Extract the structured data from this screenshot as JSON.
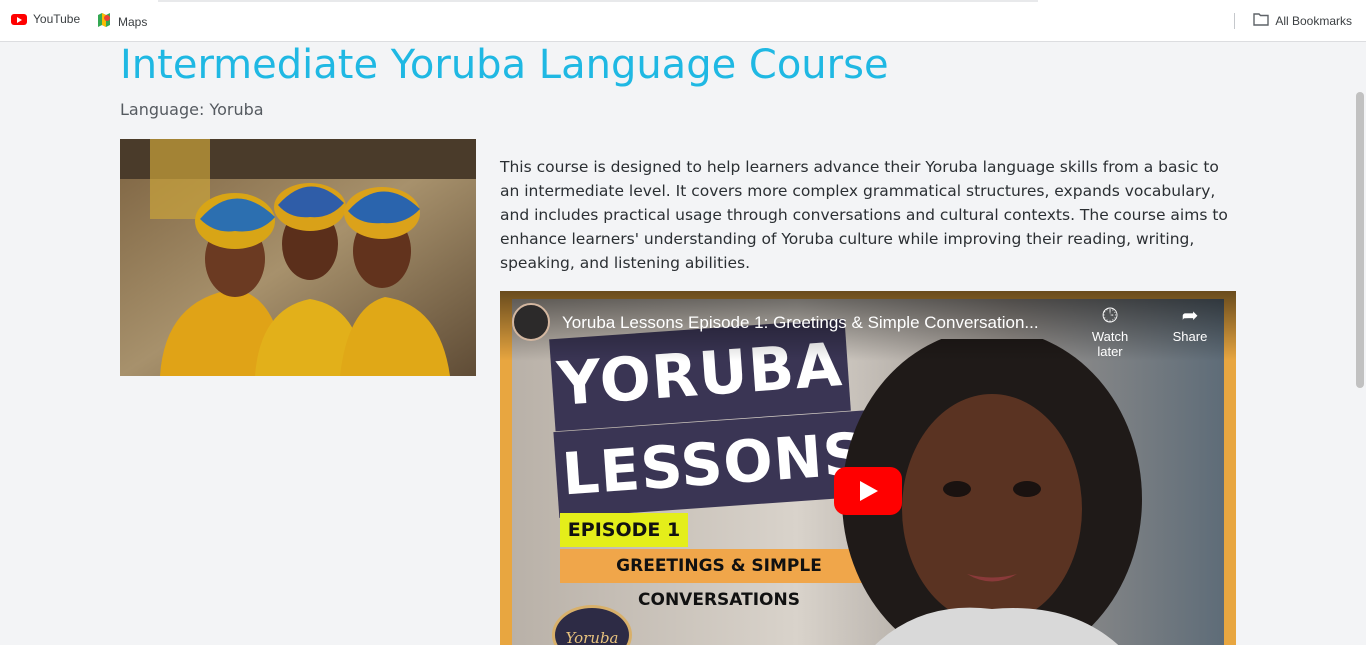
{
  "bookmarks": {
    "youtube": "YouTube",
    "maps": "Maps",
    "all": "All Bookmarks"
  },
  "course": {
    "title": "Intermediate Yoruba Language Course",
    "language": "Language: Yoruba",
    "description": "This course is designed to help learners advance their Yoruba language skills from a basic to an intermediate level. It covers more complex grammatical structures, expands vocabulary, and includes practical usage through conversations and cultural contexts. The course aims to enhance learners' understanding of Yoruba culture while improving their reading, writing, speaking, and listening abilities."
  },
  "video": {
    "title": "Yoruba Lessons Episode 1: Greetings & Simple Conversation...",
    "watch_later": "Watch later",
    "share": "Share",
    "thumb": {
      "line1": "YORUBA",
      "line2": "LESSONS",
      "episode": "EPISODE 1",
      "subtitle": "GREETINGS & SIMPLE CONVERSATIONS",
      "logo": "Yoruba"
    }
  },
  "colors": {
    "title": "#1fb8e3",
    "youtube_red": "#ff0000"
  }
}
